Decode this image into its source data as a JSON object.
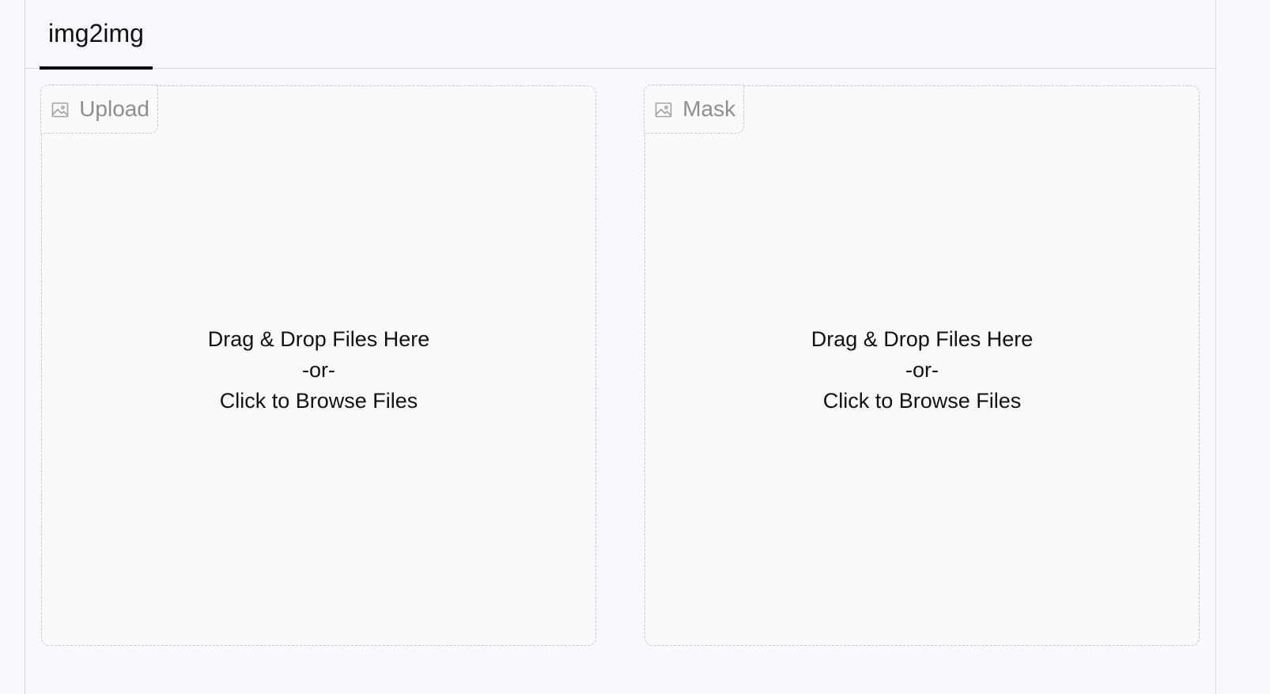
{
  "tabs": [
    {
      "label": "img2img",
      "active": true
    }
  ],
  "upload_zone": {
    "label": "Upload",
    "icon": "image-icon",
    "line1": "Drag & Drop Files Here",
    "line2": "-or-",
    "line3": "Click to Browse Files"
  },
  "mask_zone": {
    "label": "Mask",
    "icon": "image-icon",
    "line1": "Drag & Drop Files Here",
    "line2": "-or-",
    "line3": "Click to Browse Files"
  },
  "colors": {
    "background": "#f8f9fc",
    "tab_underline": "#0b0b0b",
    "dashed_border": "#c4c6ca",
    "label_text": "#8c8e92"
  }
}
